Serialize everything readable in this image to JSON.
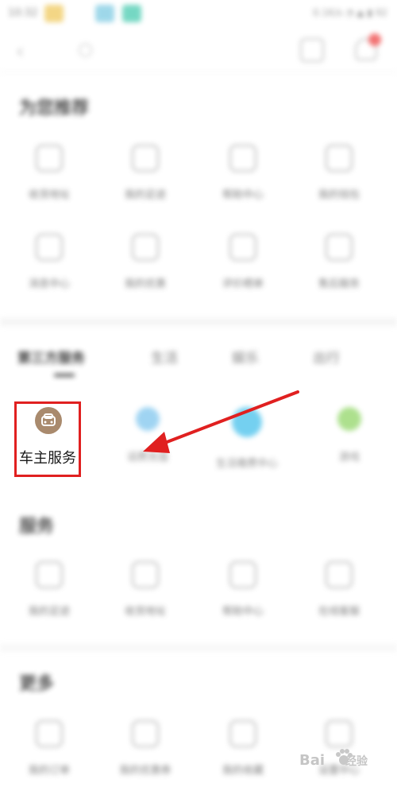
{
  "status_bar": {
    "time": "10:32",
    "right": "0.1K/s ◔ ▲ ▮ 92"
  },
  "sections": {
    "recommended_title": "为您推荐",
    "recommended_items": [
      "收货地址",
      "我的足迹",
      "帮助中心",
      "我的钱包",
      "消息中心",
      "我的优惠",
      "评价晒单",
      "售后服务"
    ],
    "tabs": [
      {
        "label": "第三方服务",
        "active": true
      },
      {
        "label": "生活",
        "active": false
      },
      {
        "label": "娱乐",
        "active": false
      },
      {
        "label": "出行",
        "active": false
      }
    ],
    "third_party_items": [
      "车主服务",
      "话费充值",
      "生活缴费中心",
      "游戏"
    ],
    "help_title": "服务",
    "help_items": [
      "我的足迹",
      "收货地址",
      "帮助中心",
      "在线客服"
    ],
    "more_title": "更多",
    "more_items": [
      "我的订单",
      "我的优惠券",
      "我的收藏",
      "设置中心"
    ]
  },
  "highlight": {
    "label": "车主服务",
    "color": "#e02020"
  },
  "watermark": {
    "text": "Bai",
    "text2": "经验"
  },
  "icons": {
    "back": "back-arrow-icon",
    "search": "search-icon",
    "basket": "shopping-bag-icon",
    "bell": "message-bell-icon",
    "car": "car-icon"
  }
}
